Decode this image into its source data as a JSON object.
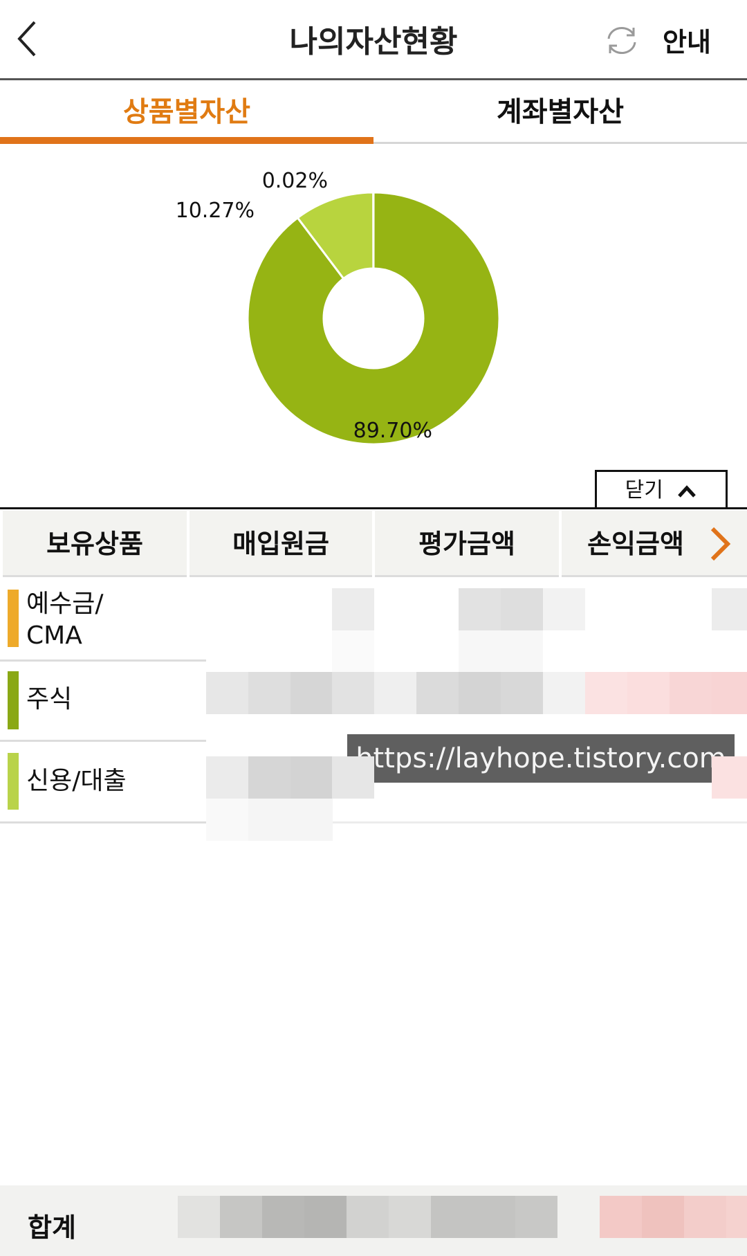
{
  "header": {
    "title": "나의자산현황",
    "guide_label": "안내",
    "back_icon": "chevron-left-icon",
    "refresh_icon": "refresh-icon"
  },
  "tabs": [
    {
      "label": "상품별자산",
      "active": true
    },
    {
      "label": "계좌별자산",
      "active": false
    }
  ],
  "chart_data": {
    "type": "pie",
    "donut": true,
    "slices": [
      {
        "label": "89.70%",
        "value": 89.7,
        "color": "#96b414"
      },
      {
        "label": "10.27%",
        "value": 10.27,
        "color": "#b8d43e"
      },
      {
        "label": "0.02%",
        "value": 0.02,
        "color": "#e8a72a"
      }
    ]
  },
  "close_button": {
    "label": "닫기",
    "icon": "chevron-up-icon"
  },
  "table": {
    "headers": [
      "보유상품",
      "매입원금",
      "평가금액",
      "손익금액"
    ],
    "more_icon": "chevron-right-icon",
    "rows": [
      {
        "label": "예수금/\nCMA",
        "color": "#eeaa2a"
      },
      {
        "label": "주식",
        "color": "#8aa815"
      },
      {
        "label": "신용/대출",
        "color": "#b9d34a"
      }
    ]
  },
  "watermark": "https://layhope.tistory.com",
  "footer": {
    "label": "합계"
  },
  "colors": {
    "accent": "#e0731a"
  }
}
